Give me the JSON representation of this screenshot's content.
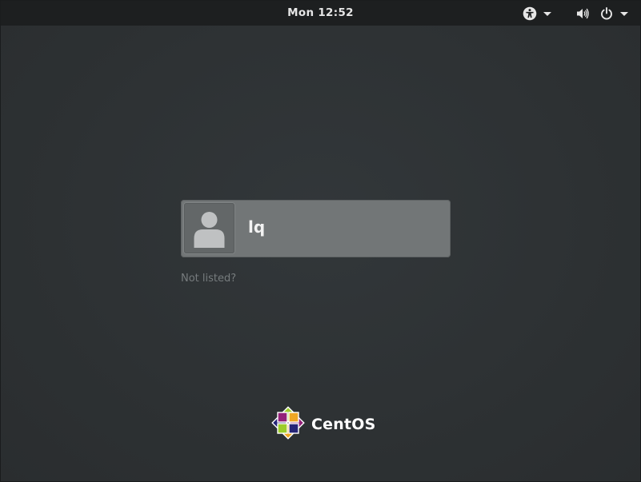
{
  "topbar": {
    "clock": "Mon 12:52",
    "accessibility_icon": "accessibility-icon",
    "volume_icon": "volume-icon",
    "power_icon": "power-icon",
    "menu_arrow_icon": "chevron-down-icon"
  },
  "login": {
    "user": {
      "name": "lq",
      "avatar_icon": "user-avatar-icon"
    },
    "not_listed_label": "Not listed?"
  },
  "branding": {
    "logo_text": "CentOS",
    "logo_icon": "centos-logo-icon"
  },
  "colors": {
    "background": "#2e3234",
    "topbar": "#1d1f20",
    "card": "#727677",
    "muted_text": "#767b7d"
  }
}
